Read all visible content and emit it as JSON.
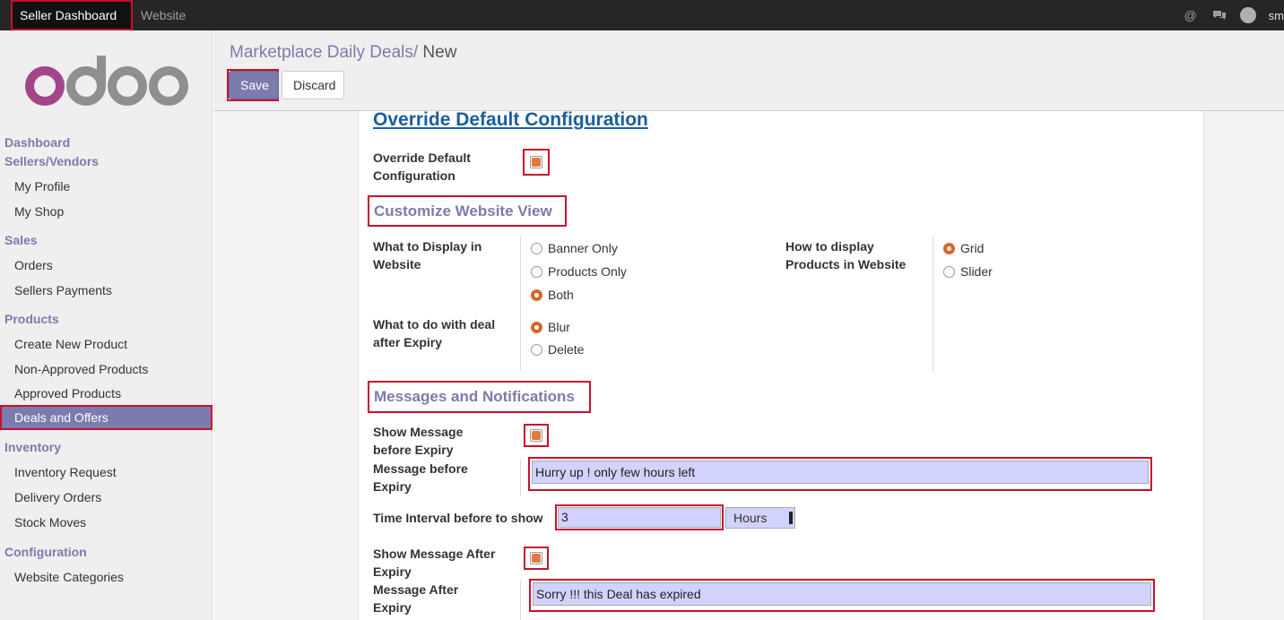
{
  "topbar": {
    "items": [
      "Seller Dashboard",
      "Website"
    ],
    "user": "sm"
  },
  "sidebar": {
    "logo": "odoo",
    "sections": [
      {
        "label": "Dashboard"
      },
      {
        "label": "Sellers/Vendors",
        "items": [
          "My Profile",
          "My Shop"
        ]
      },
      {
        "label": "Sales",
        "items": [
          "Orders",
          "Sellers Payments"
        ]
      },
      {
        "label": "Products",
        "items": [
          "Create New Product",
          "Non-Approved Products",
          "Approved Products",
          "Deals and Offers"
        ]
      },
      {
        "label": "Inventory",
        "items": [
          "Inventory Request",
          "Delivery Orders",
          "Stock Moves"
        ]
      },
      {
        "label": "Configuration",
        "items": [
          "Website Categories"
        ]
      }
    ],
    "selected": "Deals and Offers"
  },
  "header": {
    "breadcrumb_parent": "Marketplace Daily Deals",
    "breadcrumb_sep": "/",
    "breadcrumb_current": "New",
    "save_label": "Save",
    "discard_label": "Discard"
  },
  "form": {
    "title": "Override Default Configuration",
    "override_label_1": "Override Default",
    "override_label_2": "Configuration",
    "override_checked": true,
    "section_website": "Customize Website View",
    "display_label_1": "What to Display in",
    "display_label_2": "Website",
    "display_options": [
      "Banner Only",
      "Products Only",
      "Both"
    ],
    "display_selected": "Both",
    "expiry_label_1": "What to do with deal",
    "expiry_label_2": "after Expiry",
    "expiry_options": [
      "Blur",
      "Delete"
    ],
    "expiry_selected": "Blur",
    "how_label_1": "How to display",
    "how_label_2": "Products in Website",
    "how_options": [
      "Grid",
      "Slider"
    ],
    "how_selected": "Grid",
    "section_messages": "Messages and Notifications",
    "show_before_label_1": "Show Message",
    "show_before_label_2": "before Expiry",
    "show_before_checked": true,
    "msg_before_label_1": "Message before",
    "msg_before_label_2": "Expiry",
    "msg_before_value": "Hurry up ! only few hours left",
    "interval_label": "Time Interval before to show",
    "interval_value": "3",
    "interval_unit": "Hours",
    "show_after_label_1": "Show Message After",
    "show_after_label_2": "Expiry",
    "show_after_checked": true,
    "msg_after_label_1": "Message After",
    "msg_after_label_2": "Expiry",
    "msg_after_value": "Sorry !!!  this Deal has expired"
  },
  "colors": {
    "accent": "#7c7bad",
    "highlight": "#c8102e",
    "field_bg": "#d2d2ff",
    "radio_on": "#d9662b"
  }
}
